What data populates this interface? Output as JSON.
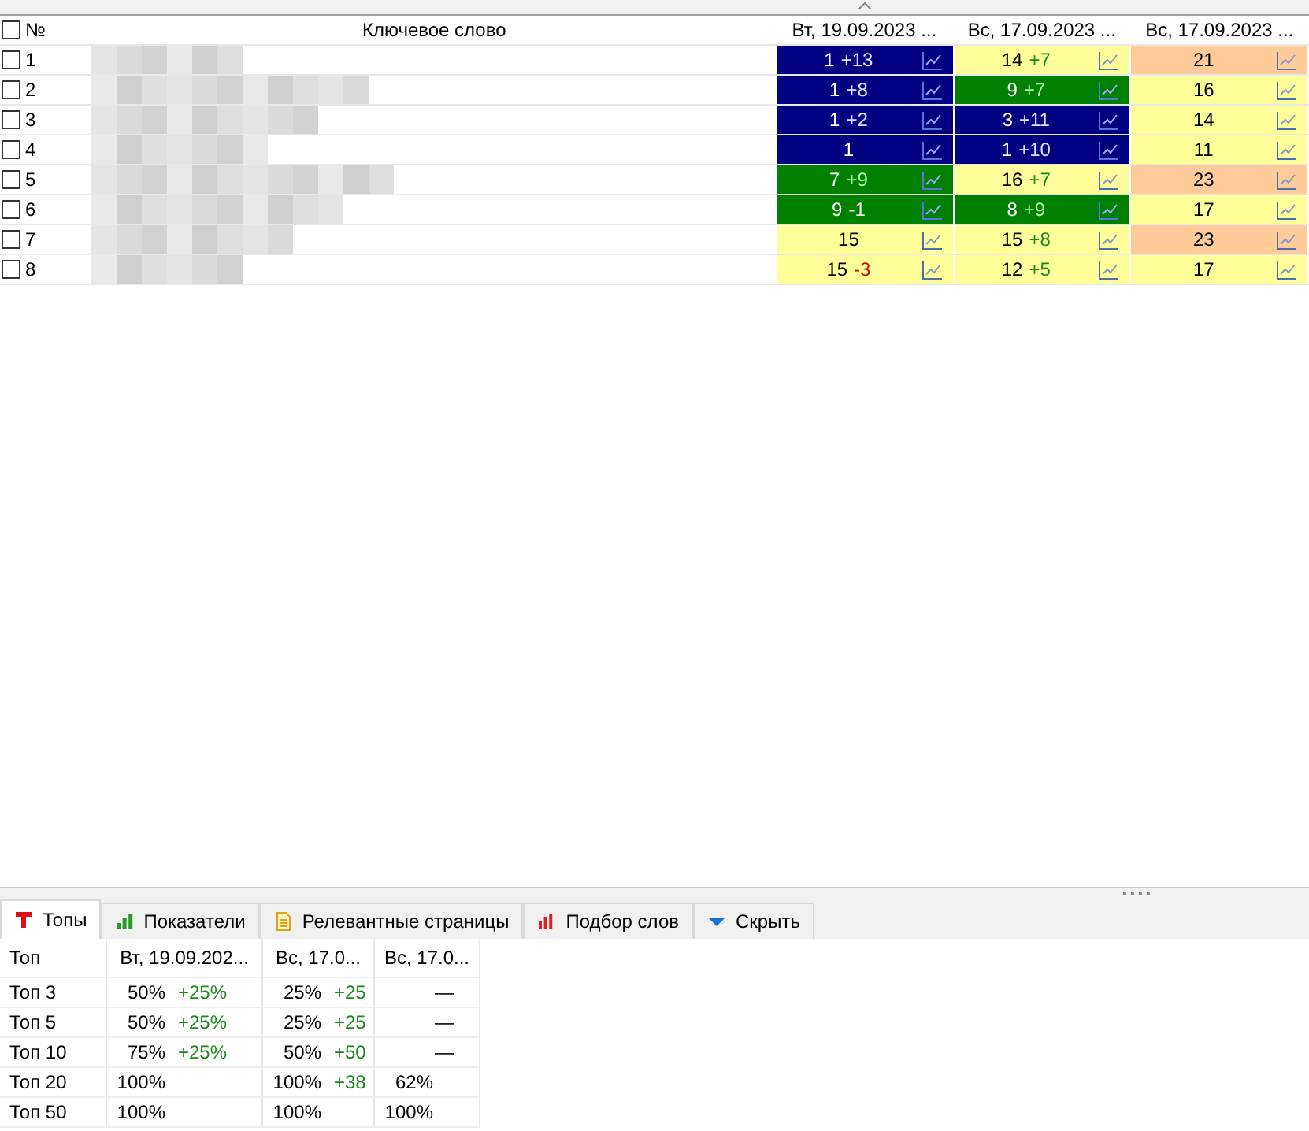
{
  "grid": {
    "select_all_checked": false,
    "number_header": "№",
    "keyword_header": "Ключевое слово",
    "columns": [
      {
        "label": "Вт, 19.09.2023 ...",
        "sorted": true
      },
      {
        "label": "Вс, 17.09.2023 ...",
        "sorted": false
      },
      {
        "label": "Вс, 17.09.2023 ...",
        "sorted": false
      }
    ],
    "rows": [
      {
        "number": "1",
        "checked": false,
        "cells": [
          {
            "value": "1",
            "delta": {
              "text": "+13",
              "color": "#dde0ff"
            },
            "color": "#000080"
          },
          {
            "value": "14",
            "delta": {
              "text": "+7",
              "color": "#1a8a1a"
            },
            "color": "#ffff99"
          },
          {
            "value": "21",
            "color": "#ffcc99"
          }
        ]
      },
      {
        "number": "2",
        "checked": false,
        "cells": [
          {
            "value": "1",
            "delta": {
              "text": "+8",
              "color": "#dde0ff"
            },
            "color": "#000080"
          },
          {
            "value": "9",
            "delta": {
              "text": "+7",
              "color": "#aaffaa"
            },
            "color": "#008000"
          },
          {
            "value": "16",
            "color": "#ffff99"
          }
        ]
      },
      {
        "number": "3",
        "checked": false,
        "cells": [
          {
            "value": "1",
            "delta": {
              "text": "+2",
              "color": "#dde0ff"
            },
            "color": "#000080"
          },
          {
            "value": "3",
            "delta": {
              "text": "+11",
              "color": "#dde0ff"
            },
            "color": "#000080"
          },
          {
            "value": "14",
            "color": "#ffff99"
          }
        ]
      },
      {
        "number": "4",
        "checked": false,
        "cells": [
          {
            "value": "1",
            "color": "#000080"
          },
          {
            "value": "1",
            "delta": {
              "text": "+10",
              "color": "#dde0ff"
            },
            "color": "#000080"
          },
          {
            "value": "11",
            "color": "#ffff99"
          }
        ]
      },
      {
        "number": "5",
        "checked": false,
        "cells": [
          {
            "value": "7",
            "delta": {
              "text": "+9",
              "color": "#aaffaa"
            },
            "color": "#008000"
          },
          {
            "value": "16",
            "delta": {
              "text": "+7",
              "color": "#1a8a1a"
            },
            "color": "#ffff99"
          },
          {
            "value": "23",
            "color": "#ffcc99"
          }
        ]
      },
      {
        "number": "6",
        "checked": false,
        "cells": [
          {
            "value": "9",
            "delta": {
              "text": "-1",
              "color": "#e8e8e8"
            },
            "color": "#008000"
          },
          {
            "value": "8",
            "delta": {
              "text": "+9",
              "color": "#aaffaa"
            },
            "color": "#008000"
          },
          {
            "value": "17",
            "color": "#ffff99"
          }
        ]
      },
      {
        "number": "7",
        "checked": false,
        "cells": [
          {
            "value": "15",
            "color": "#ffff99"
          },
          {
            "value": "15",
            "delta": {
              "text": "+8",
              "color": "#1a8a1a"
            },
            "color": "#ffff99"
          },
          {
            "value": "23",
            "color": "#ffcc99"
          }
        ]
      },
      {
        "number": "8",
        "checked": false,
        "cells": [
          {
            "value": "15",
            "delta": {
              "text": "-3",
              "color": "#cc1100"
            },
            "color": "#ffff99"
          },
          {
            "value": "12",
            "delta": {
              "text": "+5",
              "color": "#1a8a1a"
            },
            "color": "#ffff99"
          },
          {
            "value": "17",
            "color": "#ffff99"
          }
        ]
      }
    ]
  },
  "tabs": [
    {
      "label": "Топы",
      "kind": "tops",
      "selected": true
    },
    {
      "label": "Показатели",
      "kind": "stats",
      "selected": false
    },
    {
      "label": "Релевантные страницы",
      "kind": "pages",
      "selected": false
    },
    {
      "label": "Подбор слов",
      "kind": "words",
      "selected": false
    },
    {
      "label": "Скрыть",
      "kind": "hide",
      "selected": false
    }
  ],
  "tops": {
    "label_header": "Топ",
    "columns": [
      "Вт, 19.09.202...",
      "Вс, 17.0...",
      "Вс, 17.0..."
    ],
    "rows": [
      {
        "label": "Топ 3",
        "cells": [
          {
            "value": "50%",
            "delta": "+25%"
          },
          {
            "value": "25%",
            "delta": "+25"
          },
          {
            "value": "—"
          }
        ]
      },
      {
        "label": "Топ 5",
        "cells": [
          {
            "value": "50%",
            "delta": "+25%"
          },
          {
            "value": "25%",
            "delta": "+25"
          },
          {
            "value": "—"
          }
        ]
      },
      {
        "label": "Топ 10",
        "cells": [
          {
            "value": "75%",
            "delta": "+25%"
          },
          {
            "value": "50%",
            "delta": "+50"
          },
          {
            "value": "—"
          }
        ]
      },
      {
        "label": "Топ 20",
        "cells": [
          {
            "value": "100%"
          },
          {
            "value": "100%",
            "delta": "+38"
          },
          {
            "value": "62%"
          }
        ]
      },
      {
        "label": "Топ 50",
        "cells": [
          {
            "value": "100%"
          },
          {
            "value": "100%"
          },
          {
            "value": "100%"
          }
        ]
      }
    ]
  }
}
